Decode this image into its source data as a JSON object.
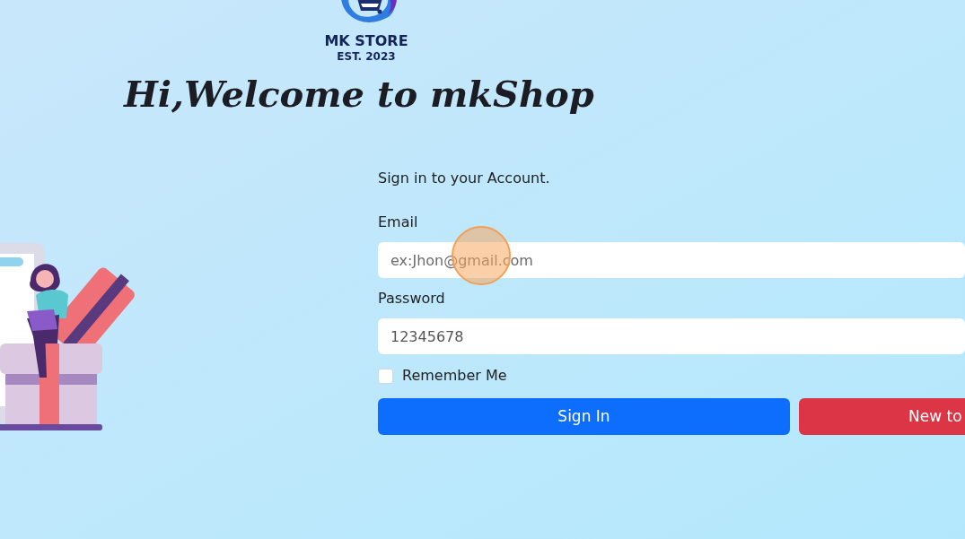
{
  "logo": {
    "name": "MK STORE",
    "tagline": "EST. 2023"
  },
  "heading": "Hi,Welcome to mkShop",
  "form": {
    "subtitle": "Sign in to your Account.",
    "fields": [
      {
        "label": "Email",
        "placeholder": "ex:Jhon@gmail.com"
      },
      {
        "label": "Password",
        "value": "12345678"
      }
    ],
    "remember": {
      "label": "Remember Me",
      "checked": false
    },
    "buttons": [
      {
        "label": "Sign In",
        "kind": "primary"
      },
      {
        "label": "New to",
        "kind": "danger"
      }
    ]
  }
}
